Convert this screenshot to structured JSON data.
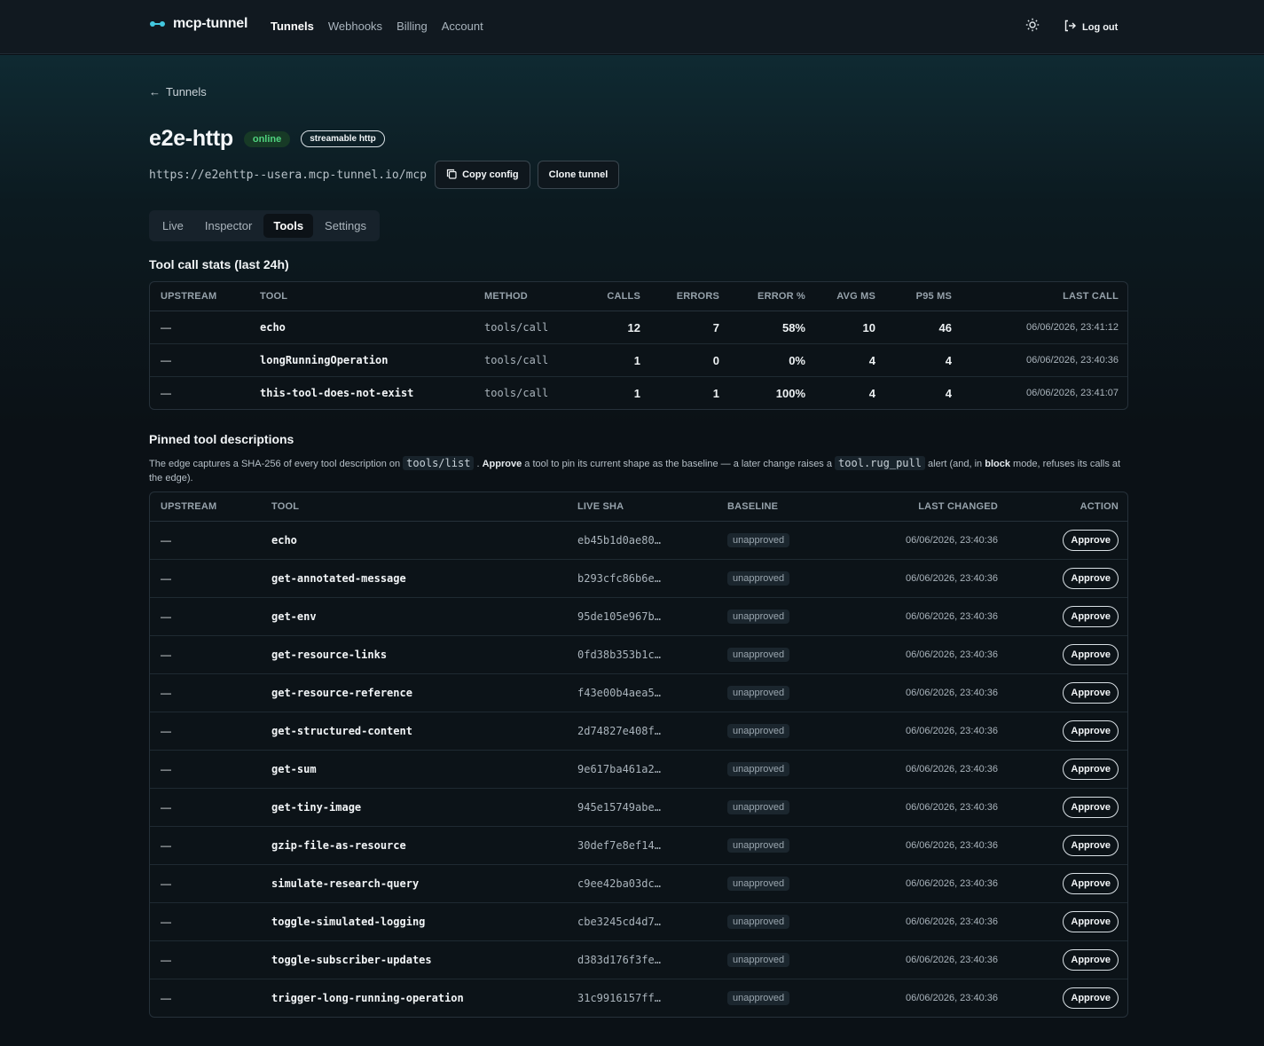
{
  "brand": {
    "name": "mcp-tunnel"
  },
  "nav": {
    "items": [
      "Tunnels",
      "Webhooks",
      "Billing",
      "Account"
    ],
    "active": "Tunnels"
  },
  "header": {
    "logout_label": "Log out"
  },
  "back_label": "Tunnels",
  "tunnel": {
    "name": "e2e-http",
    "status": "online",
    "protocol": "streamable http",
    "url": "https://e2ehttp--usera.mcp-tunnel.io/mcp",
    "copy_config_label": "Copy config",
    "clone_label": "Clone tunnel"
  },
  "tabs": [
    "Live",
    "Inspector",
    "Tools",
    "Settings"
  ],
  "stats": {
    "title": "Tool call stats (last 24h)",
    "columns": [
      "Upstream",
      "Tool",
      "Method",
      "Calls",
      "Errors",
      "Error %",
      "Avg ms",
      "P95 ms",
      "Last call"
    ],
    "rows": [
      [
        "—",
        "echo",
        "tools/call",
        "12",
        "7",
        "58%",
        "10",
        "46",
        "06/06/2026, 23:41:12"
      ],
      [
        "—",
        "longRunningOperation",
        "tools/call",
        "1",
        "0",
        "0%",
        "4",
        "4",
        "06/06/2026, 23:40:36"
      ],
      [
        "—",
        "this-tool-does-not-exist",
        "tools/call",
        "1",
        "1",
        "100%",
        "4",
        "4",
        "06/06/2026, 23:41:07"
      ]
    ]
  },
  "pins": {
    "title": "Pinned tool descriptions",
    "desc": {
      "t1": "The edge captures a SHA-256 of every tool description on ",
      "c1": "tools/list",
      "t2": " . ",
      "b1": "Approve",
      "t3": " a tool to pin its current shape as the baseline — a later change raises a ",
      "c2": "tool.rug_pull",
      "t4": " alert (and, in ",
      "b2": "block",
      "t5": " mode, refuses its calls at the edge)."
    },
    "columns": [
      "Upstream",
      "Tool",
      "Live SHA",
      "Baseline",
      "Last changed",
      "Action"
    ],
    "approve_label": "Approve",
    "rows": [
      [
        "—",
        "echo",
        "eb45b1d0ae80…",
        "unapproved",
        "06/06/2026, 23:40:36"
      ],
      [
        "—",
        "get-annotated-message",
        "b293cfc86b6e…",
        "unapproved",
        "06/06/2026, 23:40:36"
      ],
      [
        "—",
        "get-env",
        "95de105e967b…",
        "unapproved",
        "06/06/2026, 23:40:36"
      ],
      [
        "—",
        "get-resource-links",
        "0fd38b353b1c…",
        "unapproved",
        "06/06/2026, 23:40:36"
      ],
      [
        "—",
        "get-resource-reference",
        "f43e00b4aea5…",
        "unapproved",
        "06/06/2026, 23:40:36"
      ],
      [
        "—",
        "get-structured-content",
        "2d74827e408f…",
        "unapproved",
        "06/06/2026, 23:40:36"
      ],
      [
        "—",
        "get-sum",
        "9e617ba461a2…",
        "unapproved",
        "06/06/2026, 23:40:36"
      ],
      [
        "—",
        "get-tiny-image",
        "945e15749abe…",
        "unapproved",
        "06/06/2026, 23:40:36"
      ],
      [
        "—",
        "gzip-file-as-resource",
        "30def7e8ef14…",
        "unapproved",
        "06/06/2026, 23:40:36"
      ],
      [
        "—",
        "simulate-research-query",
        "c9ee42ba03dc…",
        "unapproved",
        "06/06/2026, 23:40:36"
      ],
      [
        "—",
        "toggle-simulated-logging",
        "cbe3245cd4d7…",
        "unapproved",
        "06/06/2026, 23:40:36"
      ],
      [
        "—",
        "toggle-subscriber-updates",
        "d383d176f3fe…",
        "unapproved",
        "06/06/2026, 23:40:36"
      ],
      [
        "—",
        "trigger-long-running-operation",
        "31c9916157ff…",
        "unapproved",
        "06/06/2026, 23:40:36"
      ]
    ]
  },
  "colors": {
    "accent": "#43c8e0",
    "online": "#4fd27e",
    "background": "#0b1116"
  }
}
